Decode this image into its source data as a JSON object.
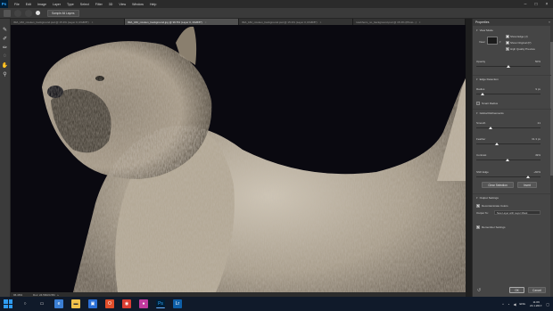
{
  "app": {
    "logo": "Ps"
  },
  "menu": [
    "File",
    "Edit",
    "Image",
    "Layer",
    "Type",
    "Select",
    "Filter",
    "3D",
    "View",
    "Window",
    "Help"
  ],
  "options": {
    "sample_all_layers_label": "Sample All Layers"
  },
  "tabs": [
    {
      "label": "IMA_182_rotoken_background.psd @ 15.3% (Layer 0, RGB/8*)",
      "active": false
    },
    {
      "label": "IMA_182_rotoken_background.jpg @ 96.5% (Layer 0, RGB/8*)",
      "active": true
    },
    {
      "label": "IMA_182_rotoken_background.psd @ 15.3% (Layer 0, RGB/8*)",
      "active": false
    },
    {
      "label": "rotebheim_no_background.psd @ 15.3% (Photo...)",
      "active": false
    }
  ],
  "status": {
    "zoom": "96.46%",
    "doc": "Doc: 24.5M/24.5M"
  },
  "properties": {
    "title": "Properties",
    "view_mode_label": "View Mode",
    "view_label": "View:",
    "show_edge_label": "Show Edge (J)",
    "show_original_label": "Show Original (P)",
    "high_quality_preview_label": "High Quality Preview",
    "opacity_label": "Opacity",
    "opacity_value": "50%",
    "opacity_pct": 0.5,
    "edge_detection_label": "Edge Detection",
    "radius_label": "Radius",
    "radius_value": "9 px",
    "smart_radius_label": "Smart Radius",
    "global_refinements_label": "Global Refinements",
    "smooth_label": "Smooth",
    "smooth_value": "21",
    "smooth_pct": 0.22,
    "feather_label": "Feather",
    "feather_value": "31.3 px",
    "feather_pct": 0.32,
    "contrast_label": "Contrast",
    "contrast_value": "49%",
    "contrast_pct": 0.49,
    "shift_edge_label": "Shift Edge",
    "shift_edge_value": "+60%",
    "shift_edge_pct": 0.8,
    "clear_selection_label": "Clear Selection",
    "invert_label": "Invert",
    "output_settings_label": "Output Settings",
    "decontaminate_label": "Decontaminate Colors",
    "output_to_label": "Output To:",
    "output_to_value": "New Layer with Layer Mask",
    "remember_settings_label": "Remember Settings",
    "ok_label": "OK",
    "cancel_label": "Cancel"
  },
  "taskbar": {
    "clock_time": "11:09",
    "clock_date": "24.1.2017.",
    "language": "ENG"
  },
  "colors": {
    "canvas_bg": "#08070d",
    "panel_bg": "#454545",
    "taskbar_bg": "#101a2a"
  }
}
